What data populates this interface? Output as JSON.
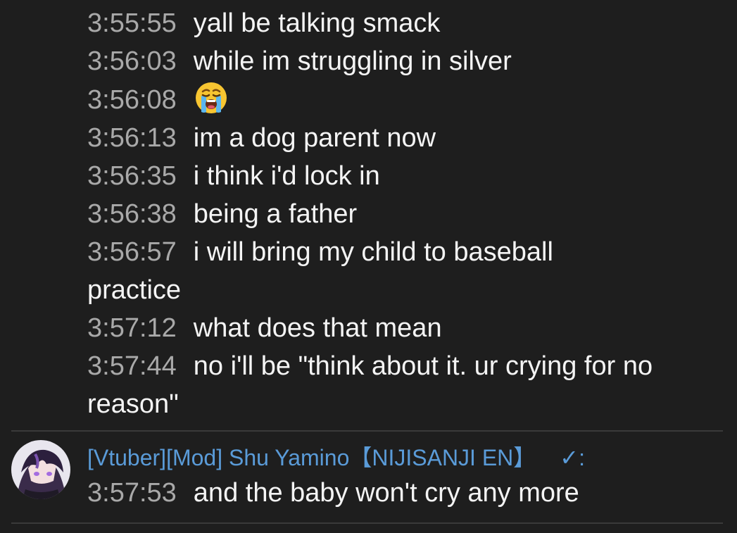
{
  "messages": [
    {
      "time": "3:55:55",
      "text": "yall be talking smack"
    },
    {
      "time": "3:56:03",
      "text": "while im struggling in silver"
    },
    {
      "time": "3:56:08",
      "text": "",
      "emoji": "loudly-crying-face"
    },
    {
      "time": "3:56:13",
      "text": "im a dog parent now"
    },
    {
      "time": "3:56:35",
      "text": "i think i'd lock in"
    },
    {
      "time": "3:56:38",
      "text": "being a father"
    },
    {
      "time": "3:56:57",
      "text": "i will bring my child to baseball practice"
    },
    {
      "time": "3:57:12",
      "text": "what does that mean"
    },
    {
      "time": "3:57:44",
      "text": "no i'll be \"think about it. ur crying for no reason\""
    }
  ],
  "author": {
    "name": "[Vtuber][Mod] Shu Yamino【NIJISANJI EN】",
    "badge": "✓:",
    "avatar_icon": "avatar-icon",
    "name_color": "#5a9bd8"
  },
  "author_message": {
    "time": "3:57:53",
    "text": "and the baby won't cry any more"
  },
  "colors": {
    "background": "#1e1e1e",
    "timestamp": "#a9a9a9",
    "text": "#f4f4f4"
  }
}
